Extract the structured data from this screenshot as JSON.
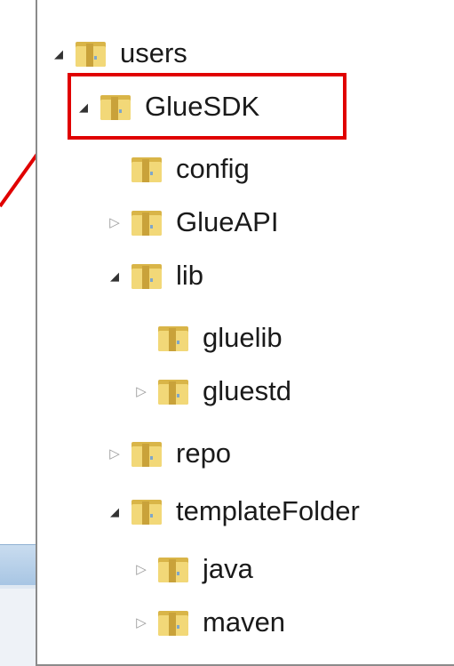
{
  "tree": {
    "nodes": [
      {
        "label": "users",
        "state": "expanded",
        "icon": "folder-icon"
      },
      {
        "label": "GlueSDK",
        "state": "expanded",
        "icon": "folder-icon",
        "highlighted": true
      },
      {
        "label": "config",
        "state": "none",
        "icon": "folder-icon"
      },
      {
        "label": "GlueAPI",
        "state": "collapsed",
        "icon": "folder-icon"
      },
      {
        "label": "lib",
        "state": "expanded",
        "icon": "folder-icon"
      },
      {
        "label": "gluelib",
        "state": "none",
        "icon": "folder-icon"
      },
      {
        "label": "gluestd",
        "state": "collapsed",
        "icon": "folder-icon"
      },
      {
        "label": "repo",
        "state": "collapsed",
        "icon": "folder-icon"
      },
      {
        "label": "templateFolder",
        "state": "expanded",
        "icon": "folder-icon"
      },
      {
        "label": "java",
        "state": "collapsed",
        "icon": "folder-icon"
      },
      {
        "label": "maven",
        "state": "collapsed",
        "icon": "folder-icon"
      }
    ]
  },
  "colors": {
    "highlight": "#e00000",
    "pointer": "#e00000",
    "folder": "#e8c85a"
  }
}
